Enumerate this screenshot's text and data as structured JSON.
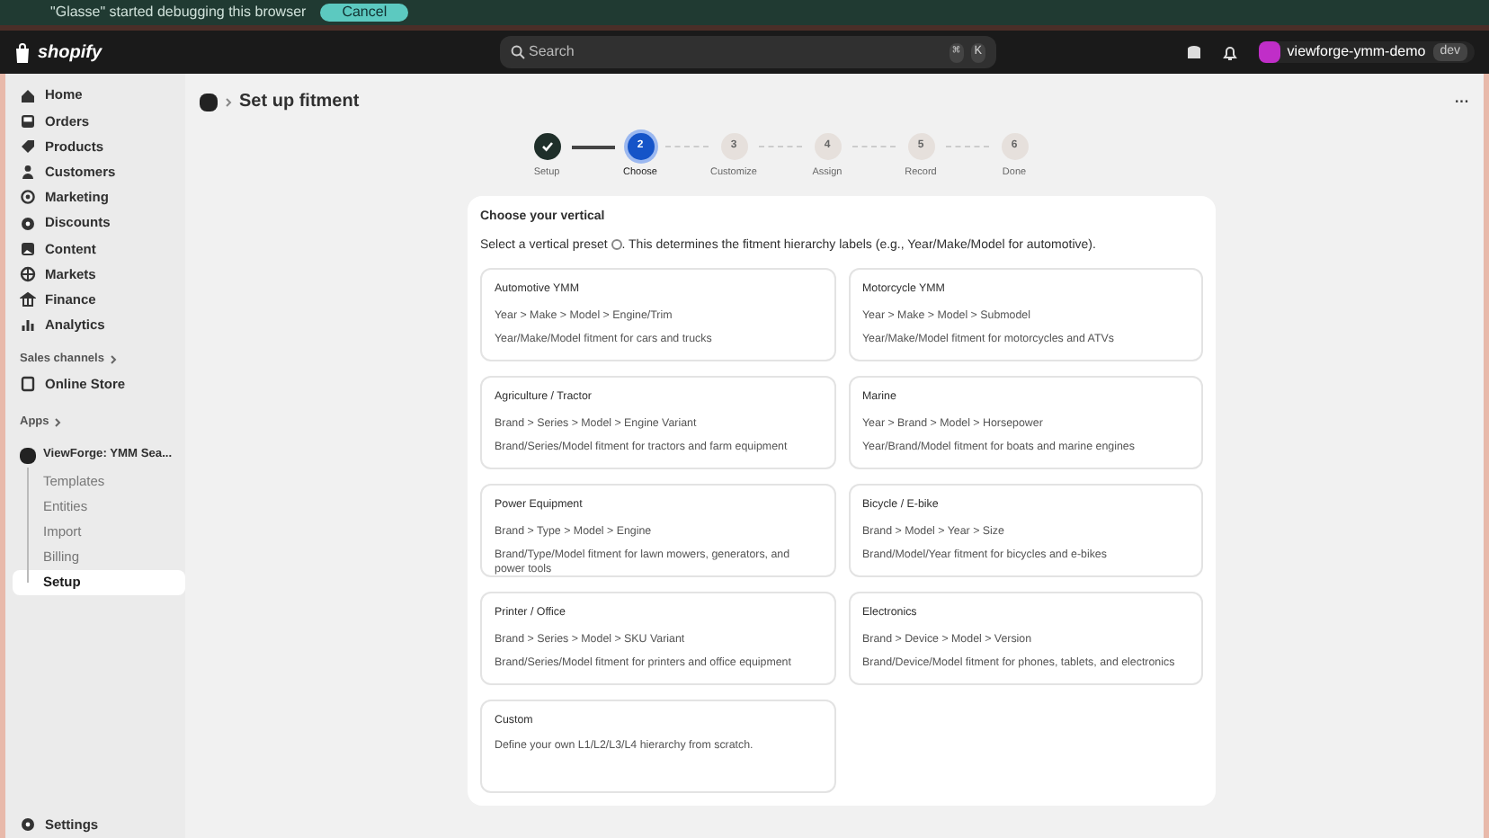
{
  "banner": {
    "text": "\"Glasse\" started debugging this browser",
    "button": "Cancel"
  },
  "topbar": {
    "logo": "shopify",
    "search": {
      "placeholder": "Search"
    },
    "shortcut": [
      "⌘",
      "K"
    ],
    "store": "viewforge-ymm-demo",
    "badge": "dev"
  },
  "sidebar": {
    "items": [
      {
        "label": "Home",
        "selected": false
      },
      {
        "label": "Orders",
        "selected": false
      },
      {
        "label": "Products",
        "selected": false
      },
      {
        "label": "Customers",
        "selected": false
      },
      {
        "label": "Marketing",
        "selected": false
      },
      {
        "label": "Discounts",
        "selected": false
      },
      {
        "label": "Content",
        "selected": false
      },
      {
        "label": "Markets",
        "selected": false
      },
      {
        "label": "Finance",
        "selected": false
      },
      {
        "label": "Analytics",
        "selected": false
      }
    ],
    "sales_channels": {
      "heading": "Sales channels",
      "items": [
        {
          "label": "Online Store",
          "selected": false
        }
      ]
    },
    "apps": {
      "heading": "Apps",
      "app": "ViewForge: YMM Sea...",
      "children": [
        {
          "label": "Templates",
          "selected": false
        },
        {
          "label": "Entities",
          "selected": false
        },
        {
          "label": "Import",
          "selected": false
        },
        {
          "label": "Billing",
          "selected": false
        },
        {
          "label": "Setup",
          "selected": true
        }
      ]
    },
    "settings": "Settings"
  },
  "page": {
    "title": "Set up fitment",
    "more": "···",
    "steps": [
      {
        "label": "Setup",
        "completed": true,
        "selected": false
      },
      {
        "number": "2",
        "label": "Choose",
        "completed": false,
        "selected": true
      },
      {
        "number": "3",
        "label": "Customize",
        "completed": false,
        "selected": false
      },
      {
        "number": "4",
        "label": "Assign",
        "completed": false,
        "selected": false
      },
      {
        "number": "5",
        "label": "Record",
        "completed": false,
        "selected": false
      },
      {
        "number": "6",
        "label": "Done",
        "completed": false,
        "selected": false
      }
    ],
    "card": {
      "heading": "Choose your vertical",
      "intro_before": "Select a vertical preset",
      "intro_after": ". This determines the fitment hierarchy labels (e.g., Year/Make/Model for automotive).",
      "options": [
        {
          "title": "Automotive YMM",
          "path": "Year > Make > Model > Engine/Trim",
          "description": "Year/Make/Model fitment for cars and trucks"
        },
        {
          "title": "Motorcycle YMM",
          "path": "Year > Make > Model > Submodel",
          "description": "Year/Make/Model fitment for motorcycles and ATVs"
        },
        {
          "title": "Agriculture / Tractor",
          "path": "Brand > Series > Model > Engine Variant",
          "description": "Brand/Series/Model fitment for tractors and farm equipment"
        },
        {
          "title": "Marine",
          "path": "Year > Brand > Model > Horsepower",
          "description": "Year/Brand/Model fitment for boats and marine engines"
        },
        {
          "title": "Power Equipment",
          "path": "Brand > Type > Model > Engine",
          "description": "Brand/Type/Model fitment for lawn mowers, generators, and power tools"
        },
        {
          "title": "Bicycle / E-bike",
          "path": "Brand > Model > Year > Size",
          "description": "Brand/Model/Year fitment for bicycles and e-bikes"
        },
        {
          "title": "Printer / Office",
          "path": "Brand > Series > Model > SKU Variant",
          "description": "Brand/Series/Model fitment for printers and office equipment"
        },
        {
          "title": "Electronics",
          "path": "Brand > Device > Model > Version",
          "description": "Brand/Device/Model fitment for phones, tablets, and electronics"
        },
        {
          "title": "Custom",
          "description": "Define your own L1/L2/L3/L4 hierarchy from scratch."
        }
      ]
    }
  }
}
